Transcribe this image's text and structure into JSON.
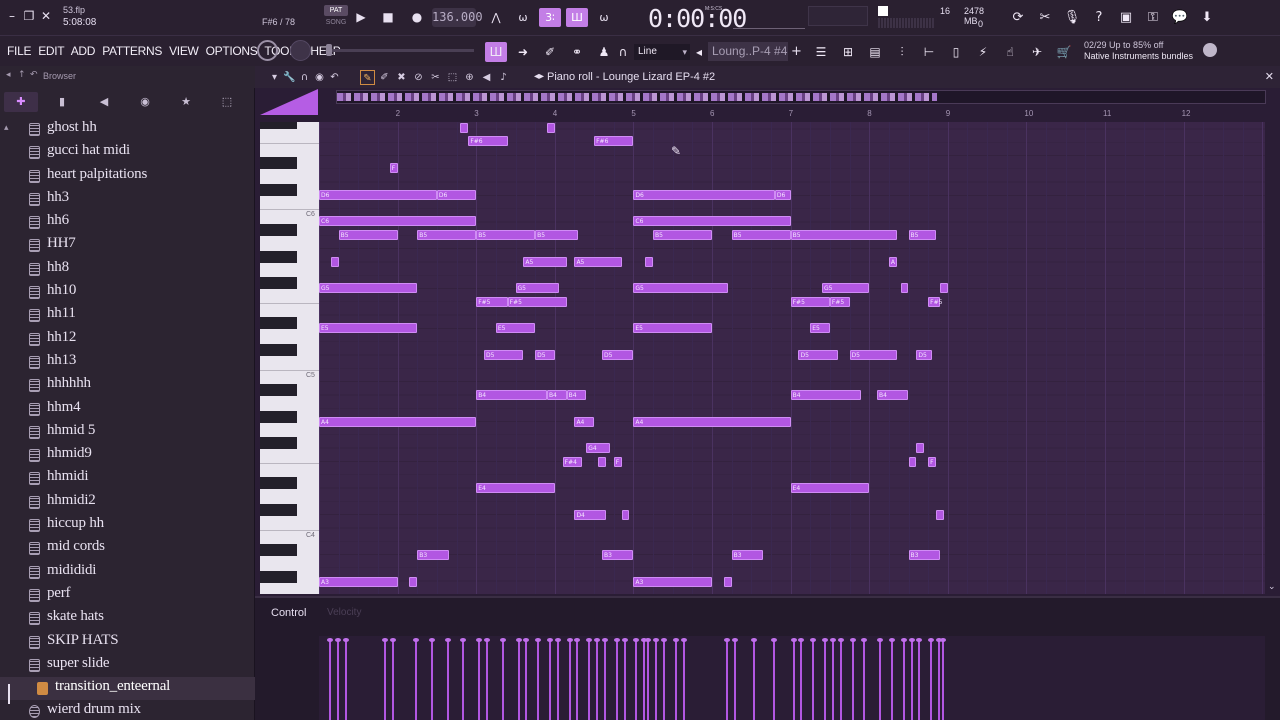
{
  "topbar": {
    "file_name": "53.flp",
    "time": "5:08:08",
    "hint": "F#6 / 78",
    "pat_label": "PAT",
    "song_label": "SONG",
    "tempo": "136.000",
    "timer": "0:00:00",
    "timer_unit": "M:S:CS",
    "cpu_voices": "16",
    "cpu_memory": "2478 MB",
    "cpu_zero": "0"
  },
  "menubar": {
    "menus": [
      "FILE",
      "EDIT",
      "ADD",
      "PATTERNS",
      "VIEW",
      "OPTIONS",
      "TOOLS",
      "HELP"
    ],
    "tool_mode": "Line",
    "pattern": "Loung..P-4 #4",
    "news_date": "02/29",
    "news_line1": "Up to 85% off",
    "news_line2": "Native Instruments bundles"
  },
  "browser": {
    "title": "Browser",
    "items": [
      {
        "label": "ghost hh"
      },
      {
        "label": "gucci hat midi"
      },
      {
        "label": "heart palpitations"
      },
      {
        "label": "hh3"
      },
      {
        "label": "hh6"
      },
      {
        "label": "HH7"
      },
      {
        "label": "hh8"
      },
      {
        "label": "hh10"
      },
      {
        "label": "hh11"
      },
      {
        "label": "hh12"
      },
      {
        "label": "hh13"
      },
      {
        "label": "hhhhhh"
      },
      {
        "label": "hhm4"
      },
      {
        "label": "hhmid 5"
      },
      {
        "label": "hhmid9"
      },
      {
        "label": "hhmidi"
      },
      {
        "label": "hhmidi2"
      },
      {
        "label": "hiccup hh"
      },
      {
        "label": "mid cords"
      },
      {
        "label": "midididi"
      },
      {
        "label": "perf"
      },
      {
        "label": "skate hats"
      },
      {
        "label": "SKIP HATS"
      },
      {
        "label": "super slide"
      },
      {
        "label": "transition_enteernal",
        "selected": true
      },
      {
        "label": "wierd drum mix",
        "gear": true
      }
    ]
  },
  "piano_roll": {
    "title": "Piano roll - Lounge Lizard EP-4 #2",
    "ruler_ticks": [
      "2",
      "3",
      "4",
      "5",
      "6",
      "7",
      "8",
      "9",
      "10",
      "11",
      "12"
    ],
    "key_labels": [
      "C6",
      "C5",
      "C4"
    ],
    "control_label": "Control",
    "control_target": "Velocity",
    "accent_color": "#b257e2"
  },
  "notes": [
    {
      "label": "",
      "col": 1.8,
      "row": 0,
      "len": 0.1
    },
    {
      "label": "",
      "col": 2.9,
      "row": 0,
      "len": 0.1
    },
    {
      "label": "F#6",
      "col": 1.9,
      "row": 1,
      "len": 0.5
    },
    {
      "label": "F#6",
      "col": 3.5,
      "row": 1,
      "len": 0.5
    },
    {
      "label": "F",
      "col": 0.9,
      "row": 3,
      "len": 0.1
    },
    {
      "label": "D6",
      "col": 0,
      "row": 5,
      "len": 1.5
    },
    {
      "label": "D6",
      "col": 1.5,
      "row": 5,
      "len": 0.5
    },
    {
      "label": "D6",
      "col": 4.0,
      "row": 5,
      "len": 1.8
    },
    {
      "label": "D6",
      "col": 5.8,
      "row": 5,
      "len": 0.2
    },
    {
      "label": "C6",
      "col": 0,
      "row": 7,
      "len": 2.0
    },
    {
      "label": "C6",
      "col": 4.0,
      "row": 7,
      "len": 2.0
    },
    {
      "label": "B5",
      "col": 0.25,
      "row": 8,
      "len": 0.75
    },
    {
      "label": "B5",
      "col": 1.25,
      "row": 8,
      "len": 0.75
    },
    {
      "label": "B5",
      "col": 2.0,
      "row": 8,
      "len": 0.75
    },
    {
      "label": "B5",
      "col": 2.75,
      "row": 8,
      "len": 0.55
    },
    {
      "label": "B5",
      "col": 4.25,
      "row": 8,
      "len": 0.75
    },
    {
      "label": "B5",
      "col": 5.25,
      "row": 8,
      "len": 0.75
    },
    {
      "label": "B5",
      "col": 6.0,
      "row": 8,
      "len": 1.35
    },
    {
      "label": "B5",
      "col": 7.5,
      "row": 8,
      "len": 0.35
    },
    {
      "label": "",
      "col": 0.15,
      "row": 10,
      "len": 0.1
    },
    {
      "label": "A5",
      "col": 2.6,
      "row": 10,
      "len": 0.55
    },
    {
      "label": "A5",
      "col": 3.25,
      "row": 10,
      "len": 0.6
    },
    {
      "label": "",
      "col": 4.15,
      "row": 10,
      "len": 0.1
    },
    {
      "label": "A",
      "col": 7.25,
      "row": 10,
      "len": 0.1
    },
    {
      "label": "G5",
      "col": 0,
      "row": 12,
      "len": 1.25
    },
    {
      "label": "G5",
      "col": 2.5,
      "row": 12,
      "len": 0.55
    },
    {
      "label": "G5",
      "col": 4.0,
      "row": 12,
      "len": 1.2
    },
    {
      "label": "G5",
      "col": 6.4,
      "row": 12,
      "len": 0.6
    },
    {
      "label": "",
      "col": 7.4,
      "row": 12,
      "len": 0.1
    },
    {
      "label": "",
      "col": 7.9,
      "row": 12,
      "len": 0.1
    },
    {
      "label": "F#5",
      "col": 2.0,
      "row": 13,
      "len": 0.4
    },
    {
      "label": "F#5",
      "col": 2.4,
      "row": 13,
      "len": 0.75
    },
    {
      "label": "F#5",
      "col": 6.0,
      "row": 13,
      "len": 0.5
    },
    {
      "label": "F#5",
      "col": 6.5,
      "row": 13,
      "len": 0.25
    },
    {
      "label": "F#5",
      "col": 7.75,
      "row": 13,
      "len": 0.15
    },
    {
      "label": "E5",
      "col": 0,
      "row": 15,
      "len": 1.25
    },
    {
      "label": "E5",
      "col": 2.25,
      "row": 15,
      "len": 0.5
    },
    {
      "label": "E5",
      "col": 4.0,
      "row": 15,
      "len": 1.0
    },
    {
      "label": "E5",
      "col": 6.25,
      "row": 15,
      "len": 0.25
    },
    {
      "label": "D5",
      "col": 2.1,
      "row": 17,
      "len": 0.5
    },
    {
      "label": "D5",
      "col": 2.75,
      "row": 17,
      "len": 0.25
    },
    {
      "label": "D5",
      "col": 3.6,
      "row": 17,
      "len": 0.4
    },
    {
      "label": "D5",
      "col": 6.1,
      "row": 17,
      "len": 0.5
    },
    {
      "label": "D5",
      "col": 6.75,
      "row": 17,
      "len": 0.6
    },
    {
      "label": "D5",
      "col": 7.6,
      "row": 17,
      "len": 0.2
    },
    {
      "label": "B4",
      "col": 2.0,
      "row": 20,
      "len": 0.9
    },
    {
      "label": "B4",
      "col": 2.9,
      "row": 20,
      "len": 0.25
    },
    {
      "label": "B4",
      "col": 3.15,
      "row": 20,
      "len": 0.25
    },
    {
      "label": "B4",
      "col": 6.0,
      "row": 20,
      "len": 0.9
    },
    {
      "label": "B4",
      "col": 7.1,
      "row": 20,
      "len": 0.4
    },
    {
      "label": "A4",
      "col": 0,
      "row": 22,
      "len": 2.0
    },
    {
      "label": "A4",
      "col": 3.25,
      "row": 22,
      "len": 0.25
    },
    {
      "label": "A4",
      "col": 4.0,
      "row": 22,
      "len": 2.0
    },
    {
      "label": "G4",
      "col": 3.4,
      "row": 24,
      "len": 0.3
    },
    {
      "label": "",
      "col": 7.6,
      "row": 24,
      "len": 0.1
    },
    {
      "label": "F#4",
      "col": 3.1,
      "row": 25,
      "len": 0.25
    },
    {
      "label": "",
      "col": 3.55,
      "row": 25,
      "len": 0.1
    },
    {
      "label": "F",
      "col": 3.75,
      "row": 25,
      "len": 0.1
    },
    {
      "label": "",
      "col": 7.5,
      "row": 25,
      "len": 0.1
    },
    {
      "label": "F",
      "col": 7.75,
      "row": 25,
      "len": 0.1
    },
    {
      "label": "E4",
      "col": 2.0,
      "row": 27,
      "len": 1.0
    },
    {
      "label": "E4",
      "col": 6.0,
      "row": 27,
      "len": 1.0
    },
    {
      "label": "D4",
      "col": 3.25,
      "row": 29,
      "len": 0.4
    },
    {
      "label": "",
      "col": 3.85,
      "row": 29,
      "len": 0.1
    },
    {
      "label": "",
      "col": 7.85,
      "row": 29,
      "len": 0.1
    },
    {
      "label": "B3",
      "col": 1.25,
      "row": 32,
      "len": 0.4
    },
    {
      "label": "B3",
      "col": 3.6,
      "row": 32,
      "len": 0.4
    },
    {
      "label": "B3",
      "col": 5.25,
      "row": 32,
      "len": 0.4
    },
    {
      "label": "B3",
      "col": 7.5,
      "row": 32,
      "len": 0.4
    },
    {
      "label": "A3",
      "col": 0,
      "row": 34,
      "len": 1.0
    },
    {
      "label": "",
      "col": 1.15,
      "row": 34,
      "len": 0.1
    },
    {
      "label": "A3",
      "col": 4.0,
      "row": 34,
      "len": 1.0
    },
    {
      "label": "",
      "col": 5.15,
      "row": 34,
      "len": 0.1
    }
  ],
  "velocities": [
    0.1,
    0.2,
    0.3,
    0.8,
    0.9,
    1.2,
    1.4,
    1.6,
    1.8,
    2.0,
    2.1,
    2.3,
    2.5,
    2.6,
    2.75,
    2.9,
    3.0,
    3.15,
    3.25,
    3.4,
    3.5,
    3.6,
    3.75,
    3.85,
    4.0,
    4.1,
    4.15,
    4.25,
    4.35,
    4.5,
    4.6,
    5.15,
    5.25,
    5.5,
    5.75,
    6.0,
    6.1,
    6.25,
    6.4,
    6.5,
    6.6,
    6.75,
    6.9,
    7.1,
    7.25,
    7.4,
    7.5,
    7.6,
    7.75,
    7.85,
    7.9
  ]
}
